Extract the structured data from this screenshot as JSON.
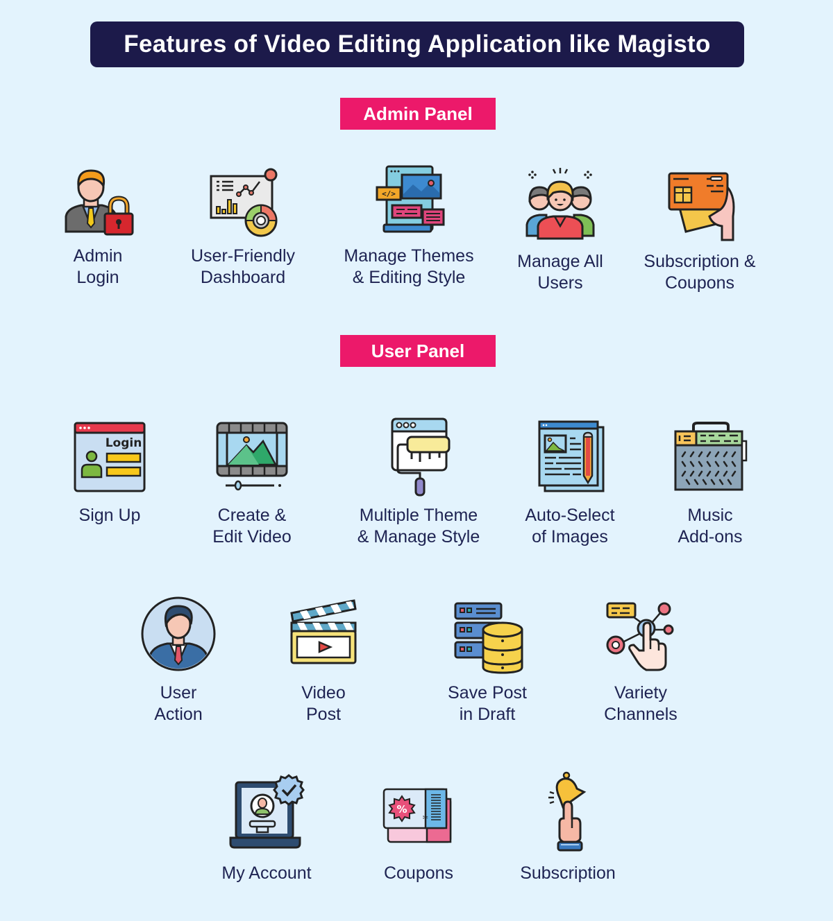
{
  "title": "Features of Video Editing Application like Magisto",
  "admin_panel": {
    "label": "Admin Panel",
    "features": [
      {
        "label": "Admin\nLogin",
        "icon": "admin-lock-icon"
      },
      {
        "label": "User-Friendly\nDashboard",
        "icon": "dashboard-chart-icon"
      },
      {
        "label": "Manage Themes\n& Editing Style",
        "icon": "themes-layout-icon"
      },
      {
        "label": "Manage All\nUsers",
        "icon": "user-group-icon"
      },
      {
        "label": "Subscription &\nCoupons",
        "icon": "card-in-hand-icon"
      }
    ]
  },
  "user_panel": {
    "label": "User Panel",
    "features": [
      {
        "label": "Sign Up",
        "icon": "login-window-icon"
      },
      {
        "label": "Create &\nEdit Video",
        "icon": "film-frame-icon"
      },
      {
        "label": "Multiple Theme\n& Manage Style",
        "icon": "paint-roller-icon"
      },
      {
        "label": "Auto-Select\nof Images",
        "icon": "document-image-pencil-icon"
      },
      {
        "label": "Music\nAdd-ons",
        "icon": "radio-icon"
      },
      {
        "label": "User\nAction",
        "icon": "user-avatar-icon"
      },
      {
        "label": "Video\nPost",
        "icon": "clapperboard-icon"
      },
      {
        "label": "Save Post\nin Draft",
        "icon": "server-database-icon"
      },
      {
        "label": "Variety\nChannels",
        "icon": "network-touch-icon"
      },
      {
        "label": "My Account",
        "icon": "laptop-verified-user-icon"
      },
      {
        "label": "Coupons",
        "icon": "coupon-ticket-icon"
      },
      {
        "label": "Subscription",
        "icon": "bell-finger-icon"
      }
    ]
  }
}
